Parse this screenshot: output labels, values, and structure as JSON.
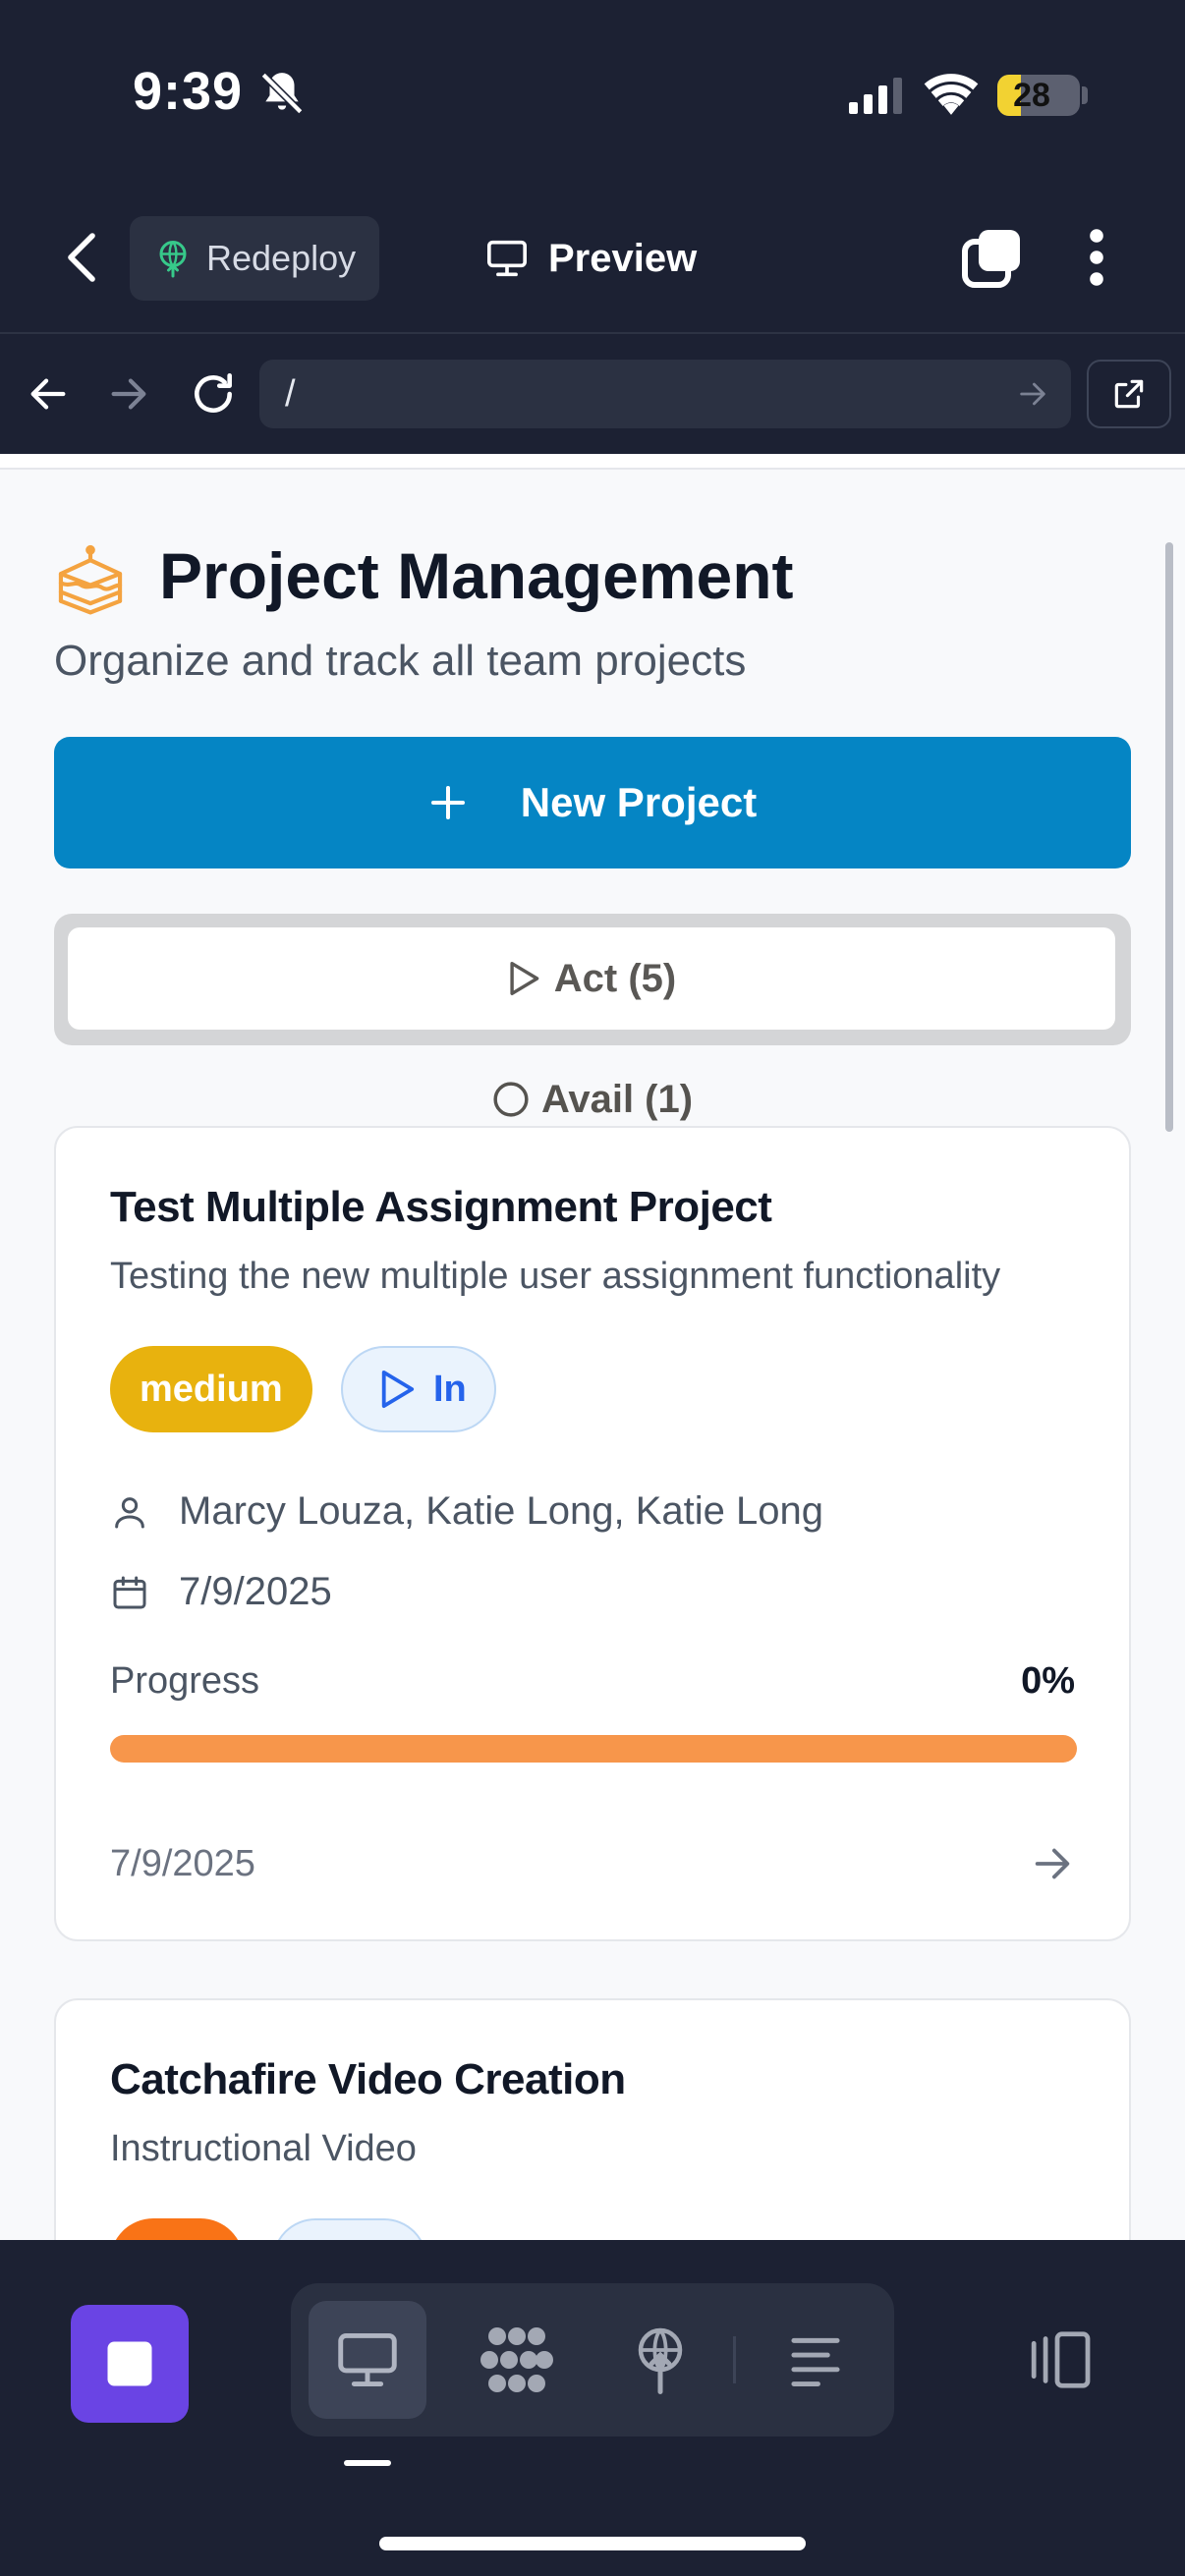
{
  "status_bar": {
    "time": "9:39",
    "battery_level": 28,
    "battery_label": "28"
  },
  "app_bar": {
    "redeploy_label": "Redeploy",
    "preview_label": "Preview"
  },
  "url_bar": {
    "url": "/"
  },
  "page": {
    "title": "Project Management",
    "subtitle": "Organize and track all team projects",
    "new_project_label": "New Project",
    "tabs": {
      "active_label": "Act (5)",
      "available_label": "Avail (1)"
    }
  },
  "projects": [
    {
      "title": "Test Multiple Assignment Project",
      "description": "Testing the new multiple user assignment functionality",
      "priority": "medium",
      "priority_color": "#e8b20e",
      "status": "In",
      "assignees": "Marcy Louza, Katie Long, Katie Long",
      "date": "7/9/2025",
      "progress_label": "Progress",
      "progress_text": "0%",
      "progress": 0,
      "footer_date": "7/9/2025"
    },
    {
      "title": "Catchafire Video Creation",
      "description": "Instructional Video",
      "priority_color": "#f97316"
    }
  ],
  "colors": {
    "accent": "#0585c4",
    "background": "#1c2133",
    "stop": "#6a44e4"
  }
}
